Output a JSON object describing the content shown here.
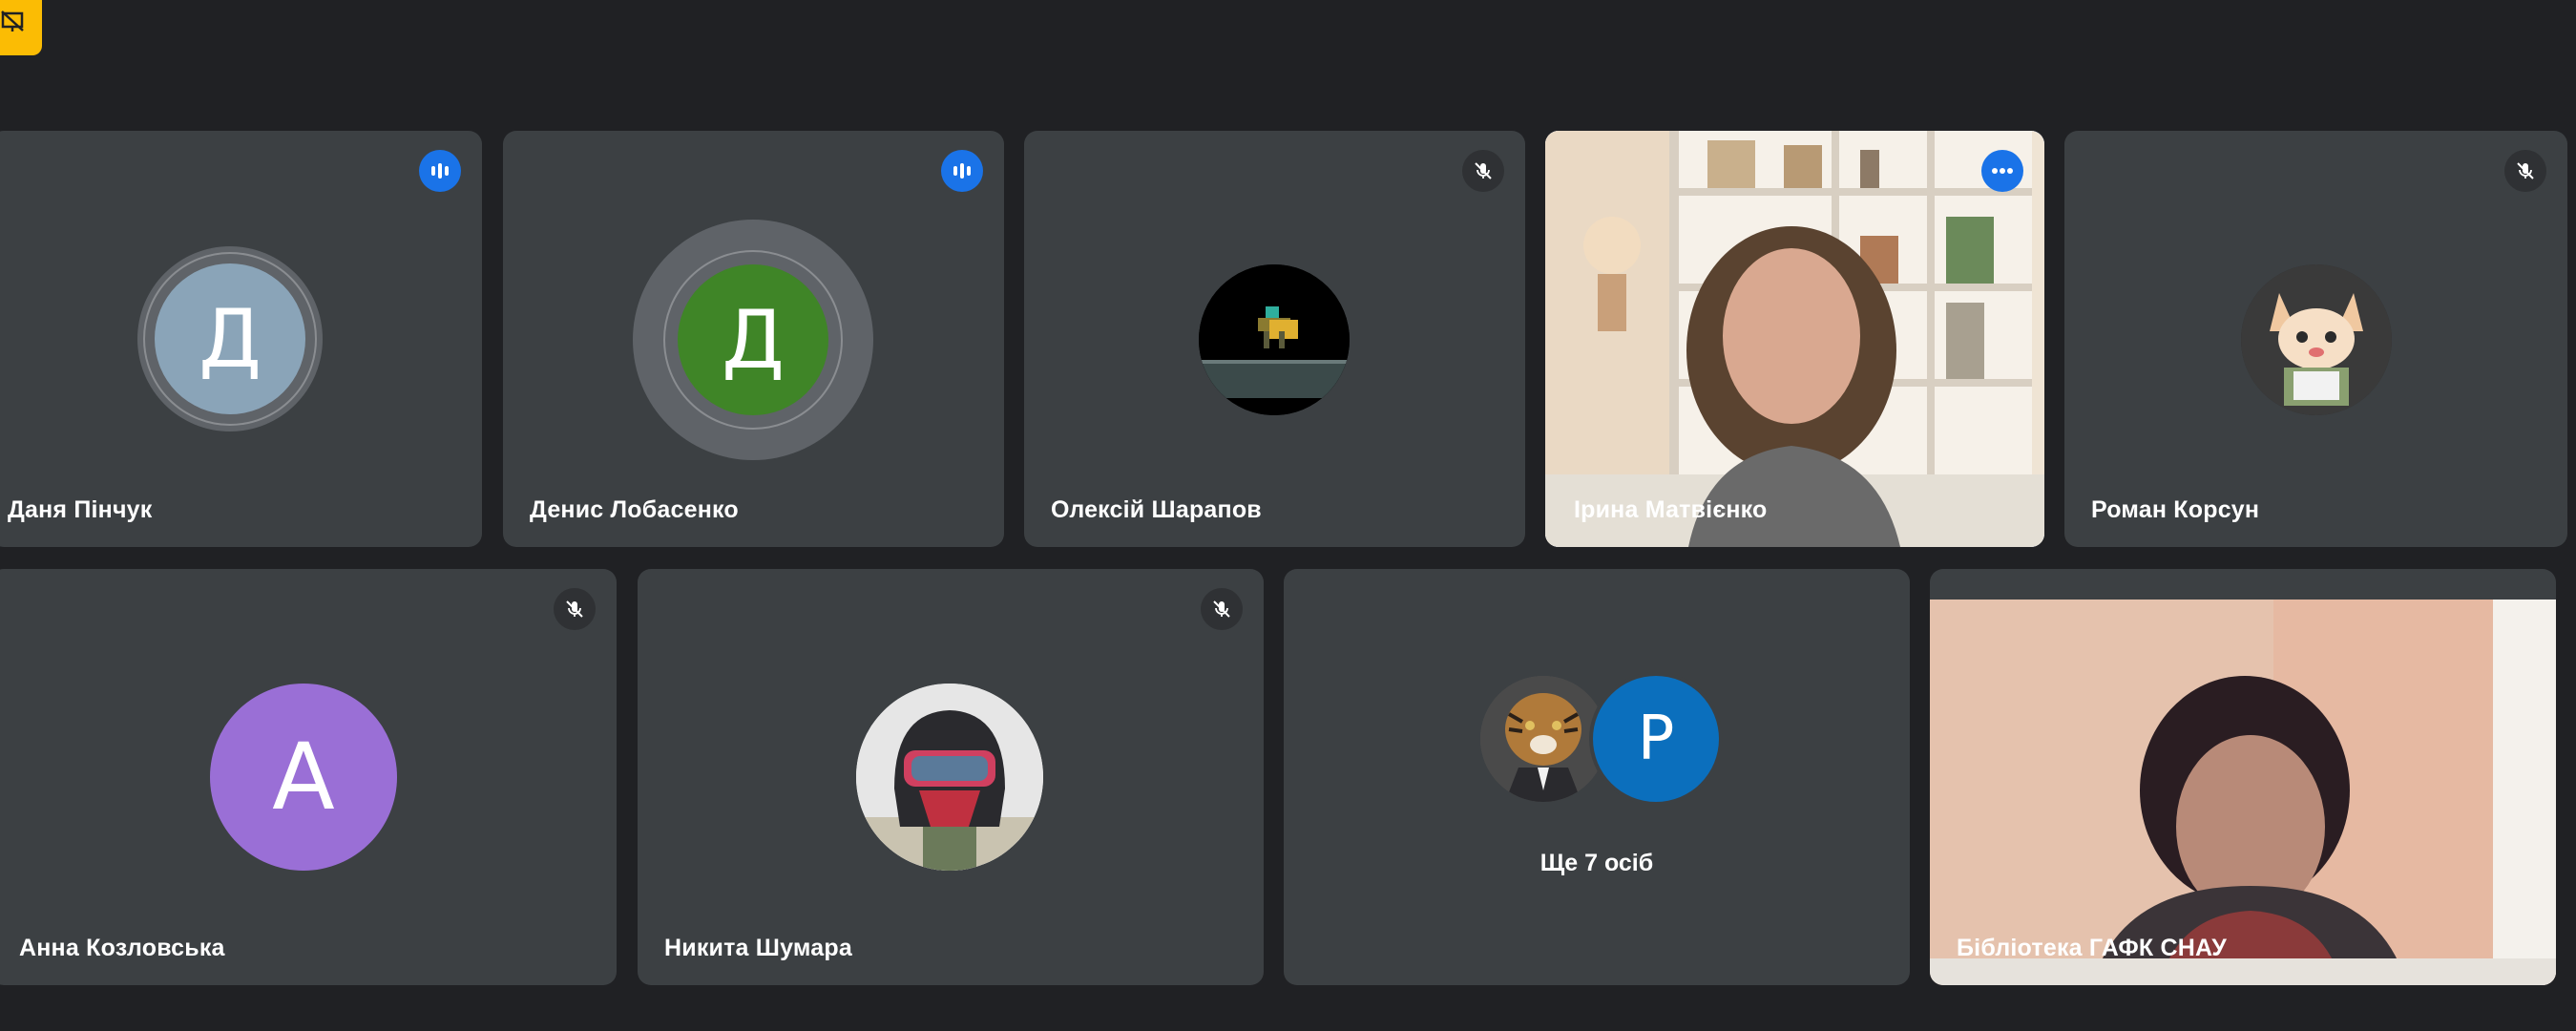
{
  "colors": {
    "background": "#202124",
    "tile": "#3c4043",
    "speaking_blue": "#1a73e8",
    "active_outline": "#8ab4f8",
    "badge_yellow": "#fbbc04"
  },
  "corner_badge": {
    "icon": "presentation-icon"
  },
  "participants": [
    {
      "name": "Даня Пінчук",
      "initial": "Д",
      "avatar_color": "#8aa4b8",
      "status": "speaking"
    },
    {
      "name": "Денис Лобасенко",
      "initial": "Д",
      "avatar_color": "#3f8527",
      "status": "speaking"
    },
    {
      "name": "Олексій Шарапов",
      "avatar": "pixel-art-photo",
      "status": "muted"
    },
    {
      "name": "Ірина Матвієнко",
      "avatar": "camera-video",
      "status": "options"
    },
    {
      "name": "Роман Корсун",
      "avatar": "cartoon-cat-photo",
      "status": "muted"
    },
    {
      "name": "Анна Козловська",
      "initial": "А",
      "avatar_color": "#9a6fd6",
      "status": "muted"
    },
    {
      "name": "Никита Шумара",
      "avatar": "helmet-photo",
      "status": "muted"
    },
    {
      "name": "Бібліотека ГАФК СНАУ",
      "avatar": "camera-video",
      "status": "none"
    }
  ],
  "overflow_tile": {
    "label": "Ще 7 осіб",
    "avatars": [
      {
        "type": "tiger-photo"
      },
      {
        "initial": "Р",
        "color": "#0b6fbd"
      }
    ]
  }
}
